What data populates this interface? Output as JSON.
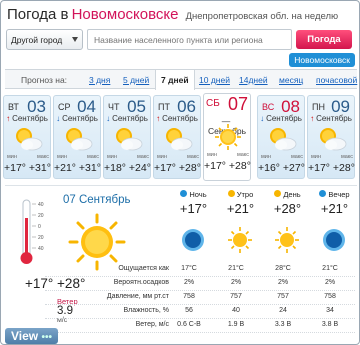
{
  "header": {
    "title": "Погода в",
    "city": "Новомосковске",
    "subtitle": "Днепропетровская обл. на неделю"
  },
  "search": {
    "city_select": "Другой город",
    "placeholder": "Название населенного пункта или региона",
    "button": "Погода",
    "city_link": "Новомосковск"
  },
  "tabs": {
    "label": "Прогноз на:",
    "items": [
      {
        "label": "3 дня"
      },
      {
        "label": "5 дней"
      },
      {
        "label": "7 дней"
      },
      {
        "label": "10 дней"
      },
      {
        "label": "14дней"
      },
      {
        "label": "месяц"
      },
      {
        "label": "почасовой"
      }
    ],
    "active": "7 дней"
  },
  "days": [
    {
      "dow": "ВТ",
      "num": "03",
      "month": "Сентябрь",
      "trend": "up",
      "icon": "sun-cloud-icon",
      "min_lbl": "мин",
      "max_lbl": "макс",
      "temps": "+17° +31°"
    },
    {
      "dow": "СР",
      "num": "04",
      "month": "Сентябрь",
      "trend": "down",
      "icon": "sun-cloud-icon",
      "min_lbl": "мин",
      "max_lbl": "макс",
      "temps": "+21° +31°"
    },
    {
      "dow": "ЧТ",
      "num": "05",
      "month": "Сентябрь",
      "trend": "down",
      "icon": "sun-cloud-icon",
      "min_lbl": "мин",
      "max_lbl": "макс",
      "temps": "+18° +24°"
    },
    {
      "dow": "ПТ",
      "num": "06",
      "month": "Сентябрь",
      "trend": "up",
      "icon": "sun-cloud-icon",
      "min_lbl": "мин",
      "max_lbl": "макс",
      "temps": "+17° +28°"
    },
    {
      "dow": "СБ",
      "num": "07",
      "month": "Сентябрь",
      "trend": "none",
      "icon": "sun-icon",
      "min_lbl": "мин",
      "max_lbl": "макс",
      "temps": "+17° +28°",
      "selected": true
    },
    {
      "dow": "ВС",
      "num": "08",
      "month": "Сентябрь",
      "trend": "down",
      "icon": "sun-cloud-icon",
      "min_lbl": "мин",
      "max_lbl": "макс",
      "temps": "+16° +27°"
    },
    {
      "dow": "ПН",
      "num": "09",
      "month": "Сентябрь",
      "trend": "up",
      "icon": "sun-cloud-icon",
      "min_lbl": "мин",
      "max_lbl": "макс",
      "temps": "+17° +28°"
    }
  ],
  "detail": {
    "date": "07 Сентябрь",
    "thermo_scale": [
      "40",
      "20",
      "0",
      "20",
      "40"
    ],
    "temps": "+17°  +28°",
    "wind_label": "Ветер",
    "wind_value": "3.9",
    "wind_unit": "м/с",
    "periods": [
      {
        "name": "Ночь",
        "temp": "+17°",
        "icon": "moon-icon"
      },
      {
        "name": "Утро",
        "temp": "+21°",
        "icon": "sun-icon"
      },
      {
        "name": "День",
        "temp": "+28°",
        "icon": "sun-icon"
      },
      {
        "name": "Вечер",
        "temp": "+21°",
        "icon": "moon-icon"
      }
    ],
    "rows": [
      {
        "label": "Ощущается как",
        "values": [
          "17°C",
          "21°C",
          "28°C",
          "21°C"
        ]
      },
      {
        "label": "Вероятн.осадков",
        "values": [
          "2%",
          "2%",
          "2%",
          "2%"
        ]
      },
      {
        "label": "Давление, мм рт.ст",
        "values": [
          "758",
          "757",
          "757",
          "758"
        ]
      },
      {
        "label": "Влажность, %",
        "values": [
          "56",
          "40",
          "24",
          "34"
        ]
      },
      {
        "label": "Ветер, м/с",
        "values": [
          "0.6 С-В",
          "1.9 В",
          "3.3 В",
          "3.8 В"
        ]
      }
    ]
  },
  "watermark": "View",
  "colors": {
    "accent": "#d0103a",
    "link": "#1560bd",
    "button": "#d3154d"
  }
}
